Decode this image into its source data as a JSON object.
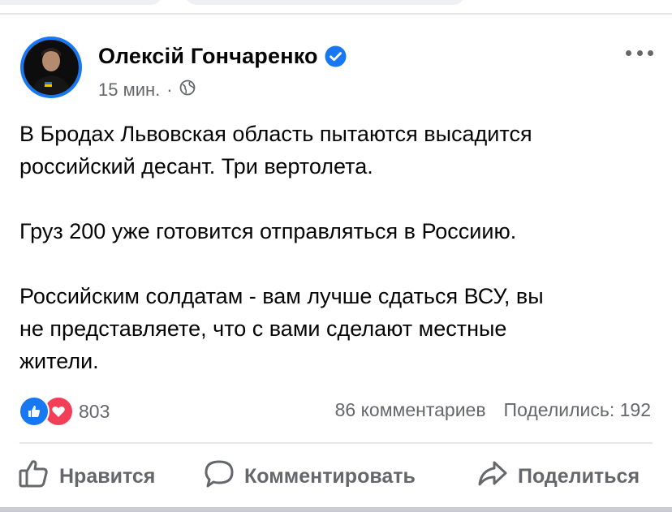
{
  "post": {
    "author": "Олексій Гончаренко",
    "time": "15 мин.",
    "separator": "·",
    "paragraphs": [
      "В Бродах Львовская область пытаются высадится\nроссийский десант. Три вертолета.",
      "Груз 200 уже готовится отправляться в Россиию.",
      "Российским солдатам - вам лучше сдаться ВСУ, вы\nне представляете, что с вами сделают местные\nжители."
    ]
  },
  "stats": {
    "reactions_count": "803",
    "comments": "86 комментариев",
    "shares": "Поделились: 192"
  },
  "actions": {
    "like": "Нравится",
    "comment": "Комментировать",
    "share": "Поделиться"
  },
  "icons": {
    "verified": "verified-badge-icon",
    "privacy": "globe-icon",
    "more": "more-options-icon",
    "like_reaction": "like-reaction-icon",
    "love_reaction": "love-reaction-icon",
    "like_action": "thumbs-up-icon",
    "comment_action": "speech-bubble-icon",
    "share_action": "share-arrow-icon"
  },
  "colors": {
    "accent": "#1877f2",
    "love": "#f33e58",
    "secondary_text": "#65676b",
    "text": "#050505"
  }
}
